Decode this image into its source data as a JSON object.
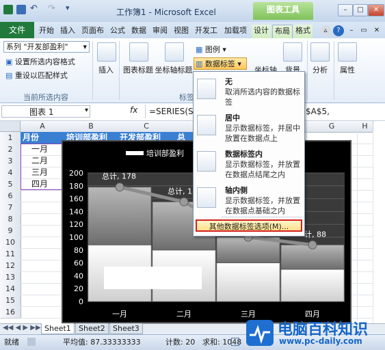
{
  "app": {
    "title": "工作簿1 - Microsoft Excel",
    "context_tab": "图表工具"
  },
  "window_buttons": [
    "–",
    "□",
    "✕"
  ],
  "ribbon_tabs": [
    "文件",
    "开始",
    "插入",
    "页面布",
    "公式",
    "数据",
    "审阅",
    "视图",
    "开发工",
    "加载项",
    "设计",
    "布局",
    "格式"
  ],
  "active_tab": "布局",
  "ribbon": {
    "selection_dropdown": "系列 \"开发部盈利\"",
    "format_selection": "设置所选内容格式",
    "reset_style": "重设以匹配样式",
    "group_current_selection": "当前所选内容",
    "insert_label": "插入",
    "chart_title_label": "图表标题",
    "axis_title_label": "坐标轴标题",
    "legend_label": "图例",
    "data_labels_label": "数据标签",
    "axis_label": "坐标轴",
    "background_label": "背景",
    "analysis_label": "分析",
    "properties_label": "属性",
    "group_labels_partial": "标签"
  },
  "formula_bar": {
    "name_box": "图表 1",
    "fx": "fx",
    "formula": "=SERIES(S",
    "formula_tail": "$A$5,"
  },
  "grid": {
    "columns": [
      "A",
      "B",
      "C",
      "D",
      "E",
      "F",
      "G",
      "H"
    ],
    "rows": [
      "1",
      "2",
      "3",
      "4",
      "5",
      "6",
      "7",
      "8",
      "9",
      "10",
      "11",
      "12",
      "13",
      "14",
      "15",
      "16"
    ],
    "header_cells": [
      "月份",
      "培训部盈利",
      "开发部盈利",
      "总"
    ],
    "months": [
      "一月",
      "二月",
      "三月",
      "四月"
    ]
  },
  "data_labels_menu": {
    "items": [
      {
        "title": "无",
        "desc": "取消所选内容的数据标签"
      },
      {
        "title": "居中",
        "desc": "显示数据标签，并居中放置在数据点上"
      },
      {
        "title": "数据标签内",
        "desc": "显示数据标签，并放置在数据点结尾之内"
      },
      {
        "title": "轴内侧",
        "desc": "显示数据标签，并放置在数据点基础之内"
      }
    ],
    "more_options": "其他数据标签选项(M)..."
  },
  "chart_data": {
    "type": "bar",
    "categories": [
      "一月",
      "二月",
      "三月",
      "四月"
    ],
    "series": [
      {
        "name": "培训部盈利",
        "values": [
          88,
          80,
          60,
          50
        ]
      },
      {
        "values": [
          90,
          75,
          40,
          38
        ]
      }
    ],
    "total_line": [
      178,
      155,
      100,
      88
    ],
    "data_labels": [
      "总计, 178",
      "总计, 15",
      "计, 88"
    ],
    "ylim": [
      0,
      200
    ],
    "yticks": [
      "0",
      "20",
      "40",
      "60",
      "80",
      "100",
      "120",
      "140",
      "160",
      "180",
      "200"
    ],
    "legend": "top",
    "grid": true
  },
  "sheets": [
    "Sheet1",
    "Sheet2",
    "Sheet3"
  ],
  "active_sheet": "Sheet1",
  "status": {
    "ready": "就绪",
    "average": "平均值: 87.33333333",
    "count": "计数: 20",
    "sum": "求和: 1048"
  },
  "watermark": {
    "title": "电脑百科知识",
    "url": "www.pc-daily.com"
  }
}
